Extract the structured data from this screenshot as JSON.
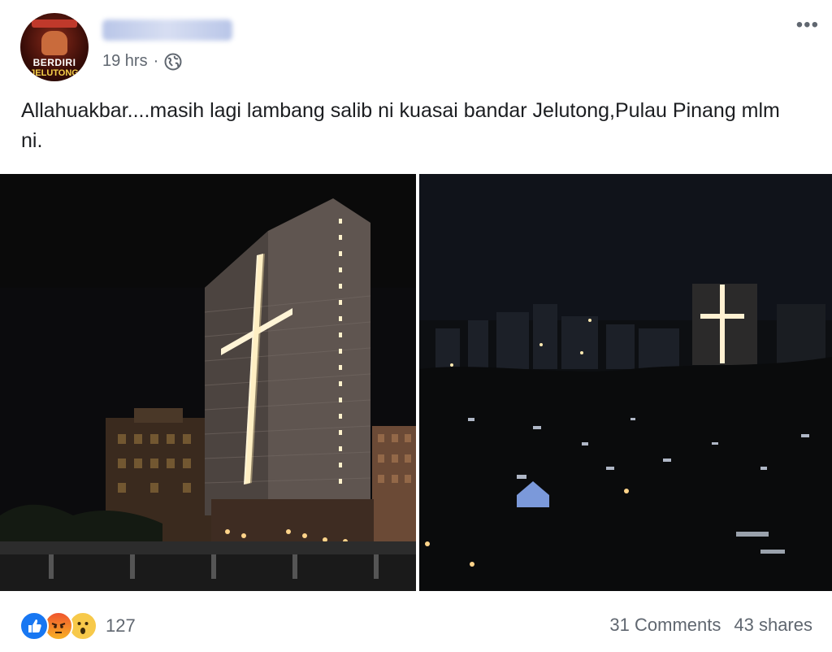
{
  "post": {
    "avatar": {
      "line1": "BERDIRI",
      "line2": "JELUTONG"
    },
    "time": "19 hrs",
    "separator": "·",
    "privacy_icon": "globe-icon",
    "more_icon": "more-options-icon",
    "more_label": "•••",
    "caption": "Allahuakbar....masih lagi lambang salib ni kuasai bandar Jelutong,Pulau Pinang mlm ni."
  },
  "photos": [
    {
      "subject": "building-with-lit-cross"
    },
    {
      "subject": "city-skyline-with-lit-cross"
    }
  ],
  "footer": {
    "reaction_icons": [
      "like-icon",
      "angry-icon",
      "wow-icon"
    ],
    "reaction_count": "127",
    "comments": "31 Comments",
    "shares": "43 shares"
  },
  "colors": {
    "like": "#1877f2",
    "angry": "#f0552e",
    "wow": "#f7c94a",
    "meta_text": "#606770"
  }
}
